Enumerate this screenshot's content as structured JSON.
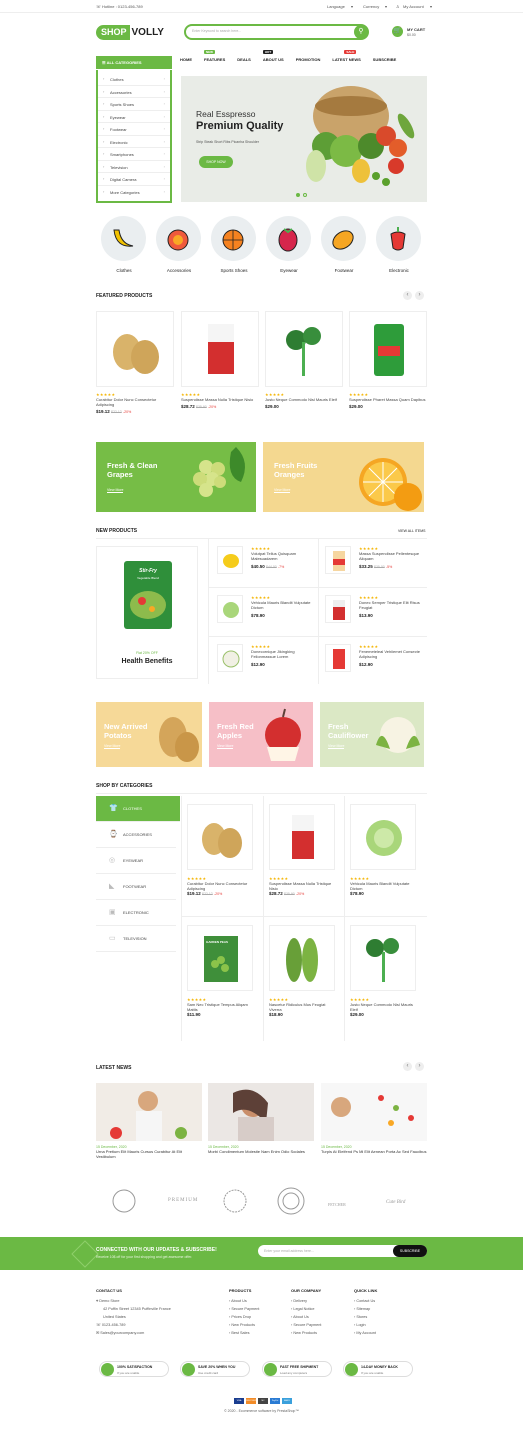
{
  "topbar": {
    "hotline": "Hotline : 0123-456-789",
    "language": "Language",
    "currency": "Currency",
    "account": "My Account"
  },
  "header": {
    "logo_pill": "SHOP",
    "logo_rest": "VOLLY",
    "search_placeholder": "Enter Keyword to search here...",
    "cart_label": "MY CART",
    "cart_amount": "$0.00"
  },
  "categories": {
    "heading": "ALL CATEGORIES",
    "items": [
      "Clothes",
      "Accessories",
      "Sports Shoes",
      "Eyewear",
      "Footwear",
      "Electronic",
      "Smartphones",
      "Television",
      "Digital Camera",
      "More Categories"
    ]
  },
  "nav": {
    "items": [
      "HOME",
      "FEATURES",
      "DEALS",
      "ABOUT US",
      "PROMOTION",
      "LATEST NEWS",
      "SUBSCRIBE"
    ],
    "badges": {
      "features": "NEW",
      "about": "HOT",
      "news": "SALE"
    }
  },
  "hero": {
    "line1": "Real Esspresso",
    "line2": "Premium Quality",
    "line3": "Strip Steak Short Ribs Picanha Shoulder",
    "button": "SHOP NOW"
  },
  "icon_categories": [
    "Clothes",
    "Accessories",
    "Sports Shoes",
    "Eyewear",
    "Footwear",
    "Electronic"
  ],
  "featured": {
    "heading": "FEATURED PRODUCTS",
    "products": [
      {
        "name": "Curabitur Dolor Nunc Consectetur Adipiscing",
        "price": "$19.12",
        "old": "$22.12",
        "disc": "-20%"
      },
      {
        "name": "Suspendisse Massa Nulla Tristique Nisio",
        "price": "$28.72",
        "old": "$35.90",
        "disc": "-20%"
      },
      {
        "name": "Justo Neque Commodo Nisl Mauris Eleif",
        "price": "$29.00",
        "old": "",
        "disc": ""
      },
      {
        "name": "Suspendisse Pharet Massa Quam Dapibus",
        "price": "$29.00",
        "old": "",
        "disc": ""
      }
    ]
  },
  "banners1": [
    {
      "title": "Fresh & Clean Grapes",
      "link": "View More"
    },
    {
      "title": "Fresh Fruits Oranges",
      "link": "View More"
    }
  ],
  "new_products": {
    "heading": "NEW PRODUCTS",
    "view_all": "VIEW ALL ITEMS",
    "feature_offer": "Flat 20% OFF",
    "feature_title": "Health Benefits",
    "feature_bag": "Stir-Fry",
    "feature_bag_sub": "Vegetable Blend",
    "items": [
      {
        "name": "Volutpat Tellus Quisquam Malesuadarem",
        "price": "$40.50",
        "old": "$44.00",
        "disc": "-7%"
      },
      {
        "name": "Massa Suspendisse Pellentesque Aliquam",
        "price": "$33.25",
        "old": "$35.00",
        "disc": "-5%"
      },
      {
        "name": "Vehicula Mauris Blandit Vulputate Dictum",
        "price": "$78.90",
        "old": "",
        "disc": ""
      },
      {
        "name": "Donec Semper Tristique Elit Risus Feugiat",
        "price": "$13.90",
        "old": "",
        "disc": ""
      },
      {
        "name": "Donecornique Jikingking Felionmassue Lorem",
        "price": "$12.90",
        "old": "",
        "disc": ""
      },
      {
        "name": "Fenemeteleal Vehiiemet Consecte Adipiscing",
        "price": "$12.90",
        "old": "",
        "disc": ""
      }
    ]
  },
  "banners2": [
    {
      "title": "New Arrived Potatos",
      "link": "View More"
    },
    {
      "title": "Fresh Red Apples",
      "link": "View More"
    },
    {
      "title": "Fresh Cauliflower",
      "link": "View More"
    }
  ],
  "shop_by": {
    "heading": "SHOP BY CATEGORIES",
    "tabs": [
      "CLOTHES",
      "ACCESSORIES",
      "EYEWEAR",
      "FOOTWEAR",
      "ELECTRONIC",
      "TELEVISION"
    ],
    "products": [
      {
        "name": "Curabitur Dolor Nunc Consectetur Adipiscing",
        "price": "$19.12",
        "old": "$22.12",
        "disc": "-20%"
      },
      {
        "name": "Suspendisse Massa Nulla Tristique Nisio",
        "price": "$28.72",
        "old": "$35.90",
        "disc": "-20%"
      },
      {
        "name": "Vehicula Mauris Blandit Vulputate Dictum",
        "price": "$78.90",
        "old": "",
        "disc": ""
      },
      {
        "name": "Sam Nec Tristique Tempus Aliqam Mattis",
        "price": "$11.90",
        "old": "",
        "disc": ""
      },
      {
        "name": "Nascetur Ridiculus Mus Feugiat Viverra",
        "price": "$18.90",
        "old": "",
        "disc": ""
      },
      {
        "name": "Justo Neque Commodo Nisl Mauris Eleif",
        "price": "$29.00",
        "old": "",
        "disc": ""
      }
    ],
    "peas_label": "GARDEN PEAS"
  },
  "news": {
    "heading": "LATEST NEWS",
    "posts": [
      {
        "date": "15 December, 2020",
        "title": "Urna Pretium Elit Mauris Cursus Curabitur At Elit Vestibulum"
      },
      {
        "date": "15 December, 2020",
        "title": "Morbi Condimentum Molestie Nam Enim Odio Sodales"
      },
      {
        "date": "15 December, 2020",
        "title": "Turpis At Eleifend Ps Mi Elit Aenean Porta Ac Sed Faucibus"
      }
    ]
  },
  "brands": [
    "Brand 1",
    "PREMIUM",
    "Brand 3",
    "Brand 4",
    "FETCHER",
    "Cute Bird"
  ],
  "newsletter": {
    "title": "CONNECTED WITH OUR UPDATES & SUBSCRIBE!",
    "sub": "Receive 10$ off for your first shopping and get awesome offer.",
    "placeholder": "Enter your email address here...",
    "button": "SUBSCRIBE"
  },
  "footer": {
    "contact": {
      "heading": "CONTACT US",
      "lines": [
        "Demo Store",
        "42 Puffin Street 12345 Puffinville France",
        "United States",
        "0123-456-789",
        "Sales@yourcompany.com"
      ]
    },
    "products": {
      "heading": "PRODUCTS",
      "links": [
        "About Us",
        "Secure Payment",
        "Prices Drop",
        "New Products",
        "Best Sales"
      ]
    },
    "company": {
      "heading": "OUR COMPANY",
      "links": [
        "Delivery",
        "Legal Notice",
        "About Us",
        "Secure Payment",
        "New Products"
      ]
    },
    "quick": {
      "heading": "QUICK LINK",
      "links": [
        "Contact Us",
        "Sitemap",
        "Stores",
        "Login",
        "My Account"
      ]
    }
  },
  "features": [
    {
      "t1": "100% SATISFACTION",
      "t2": "If you are unable"
    },
    {
      "t1": "SAVE 20% WHEN YOU",
      "t2": "Use credit card"
    },
    {
      "t1": "FAST FREE SHIPMENT",
      "t2": "Load any computers"
    },
    {
      "t1": "14-DAY MONEY BACK",
      "t2": "If you are unable"
    }
  ],
  "payments": [
    "VISA",
    "DISCOVER",
    "MC",
    "PayPal",
    "AMEX"
  ],
  "copyright": "© 2020 - Ecommerce software by PrestaShop™",
  "colors": {
    "accent": "#6bb944",
    "sale": "#e53935",
    "star": "#f4b400"
  }
}
